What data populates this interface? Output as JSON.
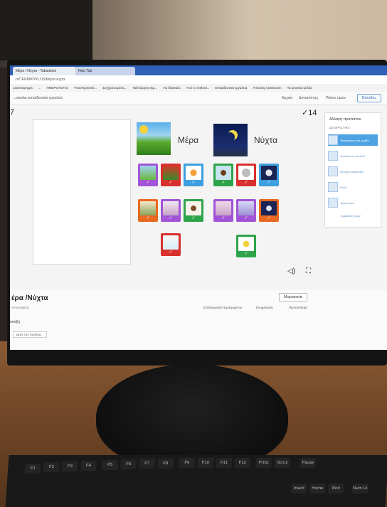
{
  "browser": {
    "tabs": [
      "Μέρα / Νύχτα - Tabulation",
      "New Tab"
    ],
    "url": "...nt/TERM/KYKLOS/Μέρα-νύχτα",
    "bookmarks": [
      "LearningApps",
      "...",
      "ΗΜΕΡΟΛΟΓΙΟ",
      "Υποστηρικτικό...",
      "Συγχρονισμένα...",
      "Ταξινόμηση εκμ...",
      "Για δάσκαλο",
      "Από το Oxford...",
      "Εκπαιδευτικά εργαλεία",
      "Amazing Classroom",
      "Τα μυστικά φύλλα"
    ]
  },
  "site_nav": {
    "left_text": "...εύκολα εκπαιδευτικά εργαλεία",
    "links": [
      "Αρχική",
      "Δυνατότητες",
      "Πλάνο τιμών"
    ],
    "login": "Είσοδος"
  },
  "game": {
    "counter_left": "7",
    "counter_right": "✓14",
    "header_day": "Μέρα",
    "header_night": "Νύχτα",
    "check": "✓"
  },
  "side_panel": {
    "title": "Αλλαγή προτύπου",
    "subtitle": "ΔΙΑΔΡΑΣΤΙΚΑ",
    "items": [
      "Ταξινόμηση ανά ομάδα",
      "Ισόπεδο σε πεντάδι",
      "Ανοιχτή οικογένεια",
      "Κουίζ",
      "Τηλεοπτικό",
      "Εμφάνιση όλων"
    ]
  },
  "bottom": {
    "title": "έρα /Νύχτα",
    "meta": "Αντιστοίχιση",
    "share_btn": "Μοιραστείτε",
    "actions": [
      "Επεξεργασία περιεχομένου",
      "Ενημέρωση",
      "Περισσότερα"
    ],
    "section": "ιστάξη",
    "template_label": "Δείτε τον πυρήνα..."
  },
  "keyboard": {
    "fn_keys": [
      "F1",
      "F2",
      "F3",
      "F4",
      "F5",
      "F6",
      "F7",
      "F8",
      "F9",
      "F10",
      "F11",
      "F12",
      "PrtSc",
      "ScrLk",
      "Pause"
    ],
    "row2": [
      "Insert",
      "Home",
      "End",
      "Num Lk"
    ]
  },
  "colors": {
    "purple": "#a155d6",
    "red": "#d8302d",
    "blue": "#3d9fe0",
    "green": "#2ea44a",
    "orange": "#e8691f"
  }
}
